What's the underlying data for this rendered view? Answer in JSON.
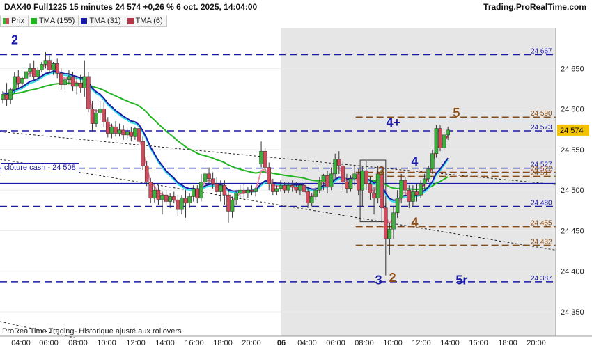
{
  "header": {
    "title": "DAX40 Full1225 15 minutes 24 574 +0,26 % 6 oct. 2025, 14:04:00",
    "site": "Trading.ProRealTime.com"
  },
  "legend": [
    {
      "label": "Prix",
      "color": "#d44"
    },
    {
      "label": "TMA (155)",
      "color": "#22b422"
    },
    {
      "label": "TMA (31)",
      "color": "#1a1aa8"
    },
    {
      "label": "TMA (6)",
      "color": "#b8324a"
    }
  ],
  "footer_note": "ProRealTime Trading- Historique ajusté aux rollovers",
  "cash_label": "clôture cash -  24 508",
  "colors": {
    "up": "#3cb03c",
    "down": "#d24b5a",
    "wick": "#333333",
    "tma155": "#22b422",
    "tma31": "#1a1aa8",
    "tma6": "#b8324a",
    "tma_cyan": "#39e0e8",
    "tma_pink": "#f08aa8",
    "level_blue": "#1a1aa8",
    "level_brown": "#8a4b14",
    "cash": "#1a1aa8"
  },
  "chart_data": {
    "type": "candlestick",
    "instrument": "DAX40 Full1225",
    "timeframe": "15 minutes",
    "last_price": 24574,
    "change_pct": "+0,26 %",
    "ylim": [
      24320,
      24700
    ],
    "y_ticks": [
      24350,
      24400,
      24450,
      24500,
      24550,
      24600,
      24650
    ],
    "x_ticks": [
      "04:00",
      "06:00",
      "08:00",
      "10:00",
      "12:00",
      "14:00",
      "16:00",
      "18:00",
      "20:00",
      "06",
      "04:00",
      "06:00",
      "08:00",
      "10:00",
      "12:00",
      "14:00",
      "16:00",
      "18:00",
      "20:00"
    ],
    "price_labels": [
      {
        "text": "24 667",
        "value": 24667,
        "color": "blue"
      },
      {
        "text": "24 590",
        "value": 24590,
        "color": "brown"
      },
      {
        "text": "24 573",
        "value": 24573,
        "color": "blue"
      },
      {
        "text": "24 527",
        "value": 24527,
        "color": "blue"
      },
      {
        "text": "24 522",
        "value": 24522,
        "color": "brown"
      },
      {
        "text": "24 517",
        "value": 24517,
        "color": "brown"
      },
      {
        "text": "24 480",
        "value": 24480,
        "color": "blue"
      },
      {
        "text": "24 455",
        "value": 24455,
        "color": "brown"
      },
      {
        "text": "24 432",
        "value": 24432,
        "color": "brown"
      },
      {
        "text": "24 387",
        "value": 24387,
        "color": "blue"
      }
    ],
    "current_price_label": "24 574",
    "h_levels": [
      {
        "value": 24667,
        "color": "blue",
        "from": 0
      },
      {
        "value": 24573,
        "color": "blue",
        "from": 0
      },
      {
        "value": 24527,
        "color": "blue",
        "from": 0
      },
      {
        "value": 24480,
        "color": "blue",
        "from": 0
      },
      {
        "value": 24387,
        "color": "blue",
        "from": 0
      },
      {
        "value": 24590,
        "color": "brown",
        "from": 0.64
      },
      {
        "value": 24522,
        "color": "brown",
        "from": 0.64
      },
      {
        "value": 24517,
        "color": "brown",
        "from": 0.64
      },
      {
        "value": 24455,
        "color": "brown",
        "from": 0.64
      },
      {
        "value": 24432,
        "color": "brown",
        "from": 0.64
      }
    ],
    "cash_close": 24508,
    "wave_labels": [
      {
        "text": "2",
        "color": "blue",
        "t": 0.02,
        "value": 24680
      },
      {
        "text": "4+",
        "color": "blue",
        "t": 0.695,
        "value": 24578
      },
      {
        "text": "5",
        "color": "brown",
        "t": 0.815,
        "value": 24590
      },
      {
        "text": "4",
        "color": "blue",
        "t": 0.74,
        "value": 24530
      },
      {
        "text": "3",
        "color": "brown",
        "t": 0.68,
        "value": 24518
      },
      {
        "text": "4",
        "color": "brown",
        "t": 0.74,
        "value": 24455
      },
      {
        "text": "3",
        "color": "blue",
        "t": 0.675,
        "value": 24384
      },
      {
        "text": "2",
        "color": "brown",
        "t": 0.7,
        "value": 24387
      },
      {
        "text": "5r",
        "color": "blue",
        "t": 0.82,
        "value": 24384
      }
    ],
    "trendlines": [
      {
        "t1": 0.0,
        "v1": 24572,
        "t2": 1.0,
        "v2": 24507
      },
      {
        "t1": 0.0,
        "v1": 24538,
        "t2": 1.0,
        "v2": 24426
      },
      {
        "t1": 0.0,
        "v1": 24338,
        "t2": 0.135,
        "v2": 24318
      }
    ],
    "box": {
      "t1": 0.648,
      "t2": 0.694,
      "v1": 24537,
      "v2": 24461
    },
    "candles": [
      {
        "t": 0.005,
        "o": 24612,
        "h": 24622,
        "c": 24618,
        "l": 24607
      },
      {
        "t": 0.012,
        "o": 24618,
        "h": 24632,
        "c": 24612,
        "l": 24604
      },
      {
        "t": 0.019,
        "o": 24612,
        "h": 24626,
        "c": 24624,
        "l": 24606
      },
      {
        "t": 0.026,
        "o": 24624,
        "h": 24645,
        "c": 24640,
        "l": 24620
      },
      {
        "t": 0.033,
        "o": 24640,
        "h": 24648,
        "c": 24632,
        "l": 24626
      },
      {
        "t": 0.04,
        "o": 24632,
        "h": 24640,
        "c": 24638,
        "l": 24625
      },
      {
        "t": 0.047,
        "o": 24638,
        "h": 24650,
        "c": 24646,
        "l": 24634
      },
      {
        "t": 0.054,
        "o": 24646,
        "h": 24656,
        "c": 24650,
        "l": 24640
      },
      {
        "t": 0.061,
        "o": 24650,
        "h": 24660,
        "c": 24640,
        "l": 24636
      },
      {
        "t": 0.068,
        "o": 24640,
        "h": 24652,
        "c": 24648,
        "l": 24634
      },
      {
        "t": 0.075,
        "o": 24648,
        "h": 24658,
        "c": 24655,
        "l": 24645
      },
      {
        "t": 0.082,
        "o": 24655,
        "h": 24670,
        "c": 24660,
        "l": 24650
      },
      {
        "t": 0.089,
        "o": 24660,
        "h": 24666,
        "c": 24648,
        "l": 24644
      },
      {
        "t": 0.096,
        "o": 24648,
        "h": 24658,
        "c": 24656,
        "l": 24642
      },
      {
        "t": 0.103,
        "o": 24656,
        "h": 24662,
        "c": 24644,
        "l": 24638
      },
      {
        "t": 0.11,
        "o": 24644,
        "h": 24650,
        "c": 24630,
        "l": 24624
      },
      {
        "t": 0.117,
        "o": 24630,
        "h": 24640,
        "c": 24636,
        "l": 24624
      },
      {
        "t": 0.124,
        "o": 24636,
        "h": 24648,
        "c": 24640,
        "l": 24630
      },
      {
        "t": 0.131,
        "o": 24640,
        "h": 24646,
        "c": 24628,
        "l": 24622
      },
      {
        "t": 0.138,
        "o": 24628,
        "h": 24640,
        "c": 24632,
        "l": 24618
      },
      {
        "t": 0.145,
        "o": 24632,
        "h": 24642,
        "c": 24626,
        "l": 24620
      },
      {
        "t": 0.152,
        "o": 24626,
        "h": 24660,
        "c": 24640,
        "l": 24615
      },
      {
        "t": 0.159,
        "o": 24640,
        "h": 24646,
        "c": 24600,
        "l": 24596
      },
      {
        "t": 0.166,
        "o": 24600,
        "h": 24610,
        "c": 24582,
        "l": 24572
      },
      {
        "t": 0.173,
        "o": 24582,
        "h": 24600,
        "c": 24595,
        "l": 24578
      },
      {
        "t": 0.18,
        "o": 24595,
        "h": 24610,
        "c": 24600,
        "l": 24586
      },
      {
        "t": 0.187,
        "o": 24600,
        "h": 24608,
        "c": 24584,
        "l": 24578
      },
      {
        "t": 0.194,
        "o": 24584,
        "h": 24590,
        "c": 24570,
        "l": 24565
      },
      {
        "t": 0.201,
        "o": 24570,
        "h": 24582,
        "c": 24578,
        "l": 24564
      },
      {
        "t": 0.208,
        "o": 24578,
        "h": 24585,
        "c": 24570,
        "l": 24566
      },
      {
        "t": 0.215,
        "o": 24570,
        "h": 24582,
        "c": 24574,
        "l": 24566
      },
      {
        "t": 0.222,
        "o": 24574,
        "h": 24580,
        "c": 24568,
        "l": 24562
      },
      {
        "t": 0.229,
        "o": 24568,
        "h": 24576,
        "c": 24572,
        "l": 24564
      },
      {
        "t": 0.236,
        "o": 24572,
        "h": 24578,
        "c": 24566,
        "l": 24560
      },
      {
        "t": 0.243,
        "o": 24566,
        "h": 24578,
        "c": 24576,
        "l": 24562
      },
      {
        "t": 0.25,
        "o": 24576,
        "h": 24580,
        "c": 24560,
        "l": 24550
      },
      {
        "t": 0.257,
        "o": 24560,
        "h": 24566,
        "c": 24530,
        "l": 24525
      },
      {
        "t": 0.264,
        "o": 24530,
        "h": 24536,
        "c": 24510,
        "l": 24505
      },
      {
        "t": 0.271,
        "o": 24510,
        "h": 24515,
        "c": 24490,
        "l": 24484
      },
      {
        "t": 0.278,
        "o": 24490,
        "h": 24505,
        "c": 24500,
        "l": 24485
      },
      {
        "t": 0.285,
        "o": 24500,
        "h": 24506,
        "c": 24488,
        "l": 24482
      },
      {
        "t": 0.292,
        "o": 24488,
        "h": 24498,
        "c": 24494,
        "l": 24470
      },
      {
        "t": 0.299,
        "o": 24494,
        "h": 24500,
        "c": 24486,
        "l": 24480
      },
      {
        "t": 0.306,
        "o": 24486,
        "h": 24496,
        "c": 24492,
        "l": 24478
      },
      {
        "t": 0.313,
        "o": 24492,
        "h": 24498,
        "c": 24488,
        "l": 24484
      },
      {
        "t": 0.32,
        "o": 24488,
        "h": 24494,
        "c": 24476,
        "l": 24468
      },
      {
        "t": 0.327,
        "o": 24476,
        "h": 24494,
        "c": 24490,
        "l": 24470
      },
      {
        "t": 0.334,
        "o": 24490,
        "h": 24500,
        "c": 24484,
        "l": 24466
      },
      {
        "t": 0.341,
        "o": 24484,
        "h": 24496,
        "c": 24492,
        "l": 24478
      },
      {
        "t": 0.348,
        "o": 24492,
        "h": 24506,
        "c": 24502,
        "l": 24486
      },
      {
        "t": 0.355,
        "o": 24502,
        "h": 24506,
        "c": 24490,
        "l": 24484
      },
      {
        "t": 0.362,
        "o": 24490,
        "h": 24520,
        "c": 24510,
        "l": 24486
      },
      {
        "t": 0.369,
        "o": 24510,
        "h": 24530,
        "c": 24520,
        "l": 24504
      },
      {
        "t": 0.376,
        "o": 24520,
        "h": 24528,
        "c": 24514,
        "l": 24508
      },
      {
        "t": 0.383,
        "o": 24514,
        "h": 24522,
        "c": 24508,
        "l": 24502
      },
      {
        "t": 0.39,
        "o": 24508,
        "h": 24516,
        "c": 24498,
        "l": 24494
      },
      {
        "t": 0.397,
        "o": 24498,
        "h": 24512,
        "c": 24506,
        "l": 24486
      },
      {
        "t": 0.404,
        "o": 24506,
        "h": 24512,
        "c": 24494,
        "l": 24482
      },
      {
        "t": 0.411,
        "o": 24494,
        "h": 24500,
        "c": 24474,
        "l": 24460
      },
      {
        "t": 0.418,
        "o": 24474,
        "h": 24492,
        "c": 24488,
        "l": 24466
      },
      {
        "t": 0.425,
        "o": 24488,
        "h": 24500,
        "c": 24496,
        "l": 24482
      },
      {
        "t": 0.432,
        "o": 24496,
        "h": 24506,
        "c": 24500,
        "l": 24490
      },
      {
        "t": 0.439,
        "o": 24500,
        "h": 24508,
        "c": 24496,
        "l": 24490
      },
      {
        "t": 0.446,
        "o": 24496,
        "h": 24504,
        "c": 24500,
        "l": 24490
      },
      {
        "t": 0.453,
        "o": 24500,
        "h": 24506,
        "c": 24498,
        "l": 24494
      },
      {
        "t": 0.46,
        "o": 24498,
        "h": 24504,
        "c": 24502,
        "l": 24492
      },
      {
        "t": 0.47,
        "o": 24532,
        "h": 24560,
        "c": 24548,
        "l": 24528
      },
      {
        "t": 0.477,
        "o": 24548,
        "h": 24552,
        "c": 24528,
        "l": 24520
      },
      {
        "t": 0.484,
        "o": 24528,
        "h": 24534,
        "c": 24508,
        "l": 24500
      },
      {
        "t": 0.491,
        "o": 24508,
        "h": 24514,
        "c": 24498,
        "l": 24494
      },
      {
        "t": 0.498,
        "o": 24498,
        "h": 24506,
        "c": 24502,
        "l": 24494
      },
      {
        "t": 0.505,
        "o": 24502,
        "h": 24512,
        "c": 24506,
        "l": 24498
      },
      {
        "t": 0.512,
        "o": 24506,
        "h": 24510,
        "c": 24500,
        "l": 24496
      },
      {
        "t": 0.519,
        "o": 24500,
        "h": 24510,
        "c": 24506,
        "l": 24496
      },
      {
        "t": 0.526,
        "o": 24506,
        "h": 24512,
        "c": 24504,
        "l": 24498
      },
      {
        "t": 0.533,
        "o": 24504,
        "h": 24510,
        "c": 24500,
        "l": 24496
      },
      {
        "t": 0.54,
        "o": 24500,
        "h": 24508,
        "c": 24506,
        "l": 24494
      },
      {
        "t": 0.547,
        "o": 24506,
        "h": 24512,
        "c": 24498,
        "l": 24494
      },
      {
        "t": 0.554,
        "o": 24498,
        "h": 24504,
        "c": 24484,
        "l": 24478
      },
      {
        "t": 0.561,
        "o": 24484,
        "h": 24496,
        "c": 24492,
        "l": 24480
      },
      {
        "t": 0.568,
        "o": 24492,
        "h": 24504,
        "c": 24500,
        "l": 24488
      },
      {
        "t": 0.575,
        "o": 24500,
        "h": 24516,
        "c": 24510,
        "l": 24496
      },
      {
        "t": 0.582,
        "o": 24510,
        "h": 24520,
        "c": 24518,
        "l": 24500
      },
      {
        "t": 0.589,
        "o": 24518,
        "h": 24524,
        "c": 24504,
        "l": 24496
      },
      {
        "t": 0.596,
        "o": 24504,
        "h": 24528,
        "c": 24520,
        "l": 24500
      },
      {
        "t": 0.603,
        "o": 24520,
        "h": 24545,
        "c": 24538,
        "l": 24514
      },
      {
        "t": 0.61,
        "o": 24538,
        "h": 24548,
        "c": 24530,
        "l": 24520
      },
      {
        "t": 0.617,
        "o": 24530,
        "h": 24536,
        "c": 24510,
        "l": 24500
      },
      {
        "t": 0.624,
        "o": 24510,
        "h": 24520,
        "c": 24502,
        "l": 24496
      },
      {
        "t": 0.631,
        "o": 24502,
        "h": 24518,
        "c": 24514,
        "l": 24498
      },
      {
        "t": 0.638,
        "o": 24514,
        "h": 24530,
        "c": 24520,
        "l": 24506
      },
      {
        "t": 0.645,
        "o": 24520,
        "h": 24526,
        "c": 24500,
        "l": 24494
      },
      {
        "t": 0.652,
        "o": 24500,
        "h": 24530,
        "c": 24524,
        "l": 24480
      },
      {
        "t": 0.659,
        "o": 24524,
        "h": 24536,
        "c": 24508,
        "l": 24500
      },
      {
        "t": 0.666,
        "o": 24508,
        "h": 24516,
        "c": 24496,
        "l": 24488
      },
      {
        "t": 0.673,
        "o": 24496,
        "h": 24504,
        "c": 24490,
        "l": 24470
      },
      {
        "t": 0.68,
        "o": 24490,
        "h": 24530,
        "c": 24520,
        "l": 24484
      },
      {
        "t": 0.687,
        "o": 24520,
        "h": 24526,
        "c": 24478,
        "l": 24460
      },
      {
        "t": 0.694,
        "o": 24478,
        "h": 24484,
        "c": 24440,
        "l": 24395
      },
      {
        "t": 0.701,
        "o": 24440,
        "h": 24460,
        "c": 24452,
        "l": 24420
      },
      {
        "t": 0.708,
        "o": 24452,
        "h": 24480,
        "c": 24472,
        "l": 24440
      },
      {
        "t": 0.715,
        "o": 24472,
        "h": 24500,
        "c": 24490,
        "l": 24466
      },
      {
        "t": 0.722,
        "o": 24490,
        "h": 24520,
        "c": 24512,
        "l": 24484
      },
      {
        "t": 0.729,
        "o": 24512,
        "h": 24516,
        "c": 24500,
        "l": 24492
      },
      {
        "t": 0.736,
        "o": 24500,
        "h": 24506,
        "c": 24486,
        "l": 24478
      },
      {
        "t": 0.743,
        "o": 24486,
        "h": 24506,
        "c": 24498,
        "l": 24480
      },
      {
        "t": 0.75,
        "o": 24498,
        "h": 24508,
        "c": 24494,
        "l": 24486
      },
      {
        "t": 0.757,
        "o": 24494,
        "h": 24512,
        "c": 24508,
        "l": 24490
      },
      {
        "t": 0.764,
        "o": 24508,
        "h": 24520,
        "c": 24514,
        "l": 24500
      },
      {
        "t": 0.771,
        "o": 24514,
        "h": 24530,
        "c": 24526,
        "l": 24510
      },
      {
        "t": 0.778,
        "o": 24526,
        "h": 24550,
        "c": 24545,
        "l": 24520
      },
      {
        "t": 0.785,
        "o": 24545,
        "h": 24580,
        "c": 24576,
        "l": 24540
      },
      {
        "t": 0.792,
        "o": 24576,
        "h": 24580,
        "c": 24552,
        "l": 24548
      },
      {
        "t": 0.799,
        "o": 24552,
        "h": 24572,
        "c": 24568,
        "l": 24550
      },
      {
        "t": 0.806,
        "o": 24568,
        "h": 24578,
        "c": 24574,
        "l": 24562
      }
    ]
  }
}
